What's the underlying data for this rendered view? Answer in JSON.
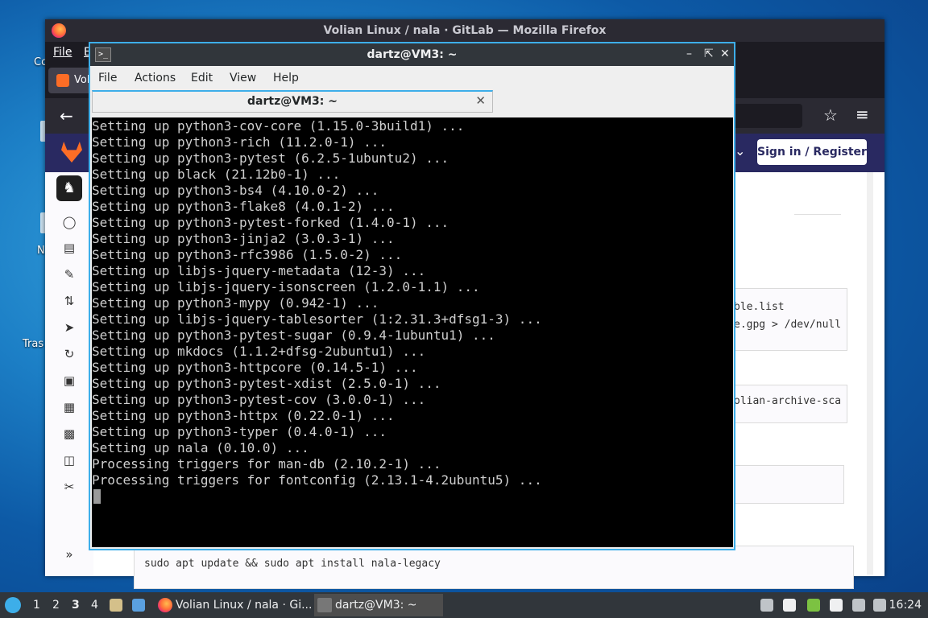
{
  "desktop": {
    "icons": [
      "Co",
      "N",
      "Tras"
    ]
  },
  "firefox": {
    "title": "Volian Linux / nala · GitLab — Mozilla Firefox",
    "menu": {
      "file": "File",
      "edit": "E"
    },
    "tab_label": "Voli",
    "gitlab": {
      "sign_in_label": "Sign in / Register",
      "code_snippets": [
        "ble.list\ne.gpg > /dev/null",
        "olian-archive-sca",
        "sudo apt update && sudo apt install nala-legacy"
      ]
    }
  },
  "terminal": {
    "title": "dartz@VM3: ~",
    "menu": [
      "File",
      "Actions",
      "Edit",
      "View",
      "Help"
    ],
    "tab_label": "dartz@VM3: ~",
    "lines": [
      "Setting up python3-cov-core (1.15.0-3build1) ...",
      "Setting up python3-rich (11.2.0-1) ...",
      "Setting up python3-pytest (6.2.5-1ubuntu2) ...",
      "Setting up black (21.12b0-1) ...",
      "Setting up python3-bs4 (4.10.0-2) ...",
      "Setting up python3-flake8 (4.0.1-2) ...",
      "Setting up python3-pytest-forked (1.4.0-1) ...",
      "Setting up python3-jinja2 (3.0.3-1) ...",
      "Setting up python3-rfc3986 (1.5.0-2) ...",
      "Setting up libjs-jquery-metadata (12-3) ...",
      "Setting up libjs-jquery-isonscreen (1.2.0-1.1) ...",
      "Setting up python3-mypy (0.942-1) ...",
      "Setting up libjs-jquery-tablesorter (1:2.31.3+dfsg1-3) ...",
      "Setting up python3-pytest-sugar (0.9.4-1ubuntu1) ...",
      "Setting up mkdocs (1.1.2+dfsg-2ubuntu1) ...",
      "Setting up python3-httpcore (0.14.5-1) ...",
      "Setting up python3-pytest-xdist (2.5.0-1) ...",
      "Setting up python3-pytest-cov (3.0.0-1) ...",
      "Setting up python3-httpx (0.22.0-1) ...",
      "Setting up python3-typer (0.4.0-1) ...",
      "Setting up nala (0.10.0) ...",
      "Processing triggers for man-db (2.10.2-1) ...",
      "Processing triggers for fontconfig (2.13.1-4.2ubuntu5) ..."
    ]
  },
  "taskbar": {
    "workspaces": [
      "1",
      "2",
      "3",
      "4"
    ],
    "active_workspace": "3",
    "windows": [
      {
        "label": "Volian Linux / nala · Gi...",
        "icon": "firefox-icon"
      },
      {
        "label": "dartz@VM3: ~",
        "icon": "terminal-icon"
      }
    ],
    "clock": "16:24"
  }
}
